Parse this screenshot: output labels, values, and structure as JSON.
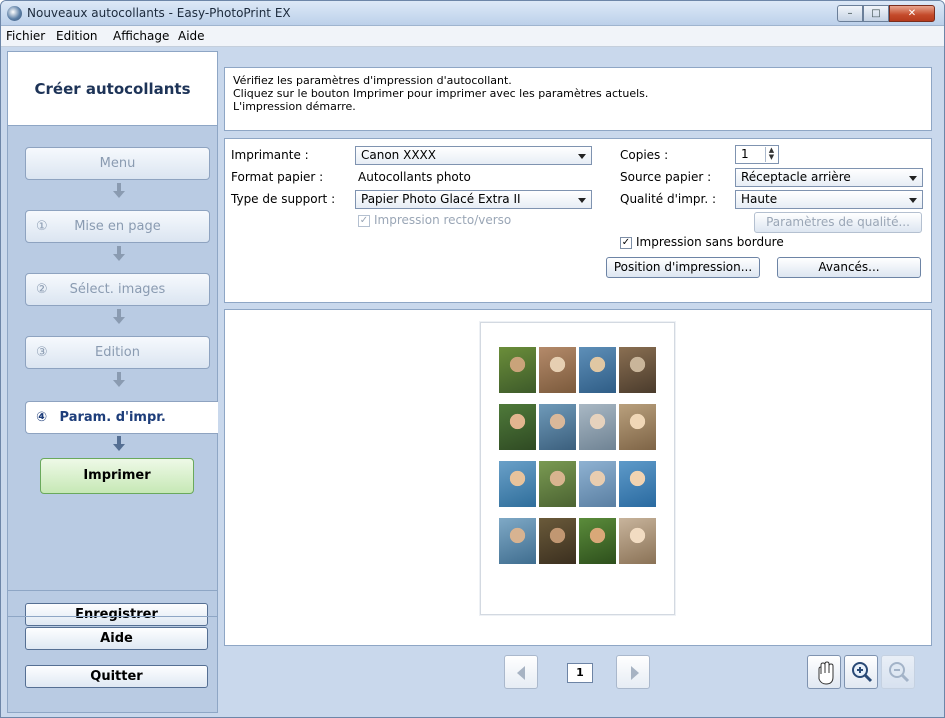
{
  "window": {
    "title": "Nouveaux autocollants - Easy-PhotoPrint EX",
    "controls": {
      "minimize": "–",
      "maximize": "□",
      "close": "✕"
    }
  },
  "menu": {
    "items": [
      {
        "label": "Fichier",
        "accel": "F"
      },
      {
        "label": "Edition",
        "accel": "E"
      },
      {
        "label": "Affichage",
        "accel": "A"
      },
      {
        "label": "Aide",
        "accel": "i"
      }
    ]
  },
  "sidebar": {
    "header": "Créer autocollants",
    "steps": [
      {
        "num": "",
        "label": "Menu"
      },
      {
        "num": "①",
        "label": "Mise en page"
      },
      {
        "num": "②",
        "label": "Sélect. images"
      },
      {
        "num": "③",
        "label": "Edition"
      }
    ],
    "active_step": {
      "num": "④",
      "label": "Param. d'impr."
    },
    "print_label": "Imprimer",
    "save_label": "Enregistrer",
    "help_label": "Aide",
    "quit_label": "Quitter"
  },
  "info": {
    "lines": [
      "Vérifiez les paramètres d'impression d'autocollant.",
      "Cliquez sur le bouton Imprimer pour imprimer avec les paramètres actuels.",
      "L'impression démarre."
    ]
  },
  "settings": {
    "printer_label": "Imprimante :",
    "printer_value": "Canon XXXX",
    "paper_format_label": "Format papier :",
    "paper_format_value": "Autocollants photo",
    "media_label": "Type de support :",
    "media_value": "Papier Photo Glacé Extra II",
    "duplex_label": "Impression recto/verso",
    "duplex_checked": true,
    "copies_label": "Copies :",
    "copies_value": "1",
    "source_label": "Source papier :",
    "source_value": "Réceptacle arrière",
    "quality_label": "Qualité d'impr. :",
    "quality_value": "Haute",
    "quality_settings_label": "Paramètres de qualité...",
    "borderless_label": "Impression sans bordure",
    "borderless_checked": true,
    "print_position_label": "Position d'impression...",
    "advanced_label": "Avancés..."
  },
  "preview": {
    "page_number": "1"
  },
  "icons": {
    "prev": "left-arrow-icon",
    "next": "right-arrow-icon",
    "hand": "hand-icon",
    "zoom_in": "zoom-in-icon",
    "zoom_out": "zoom-out-icon"
  }
}
